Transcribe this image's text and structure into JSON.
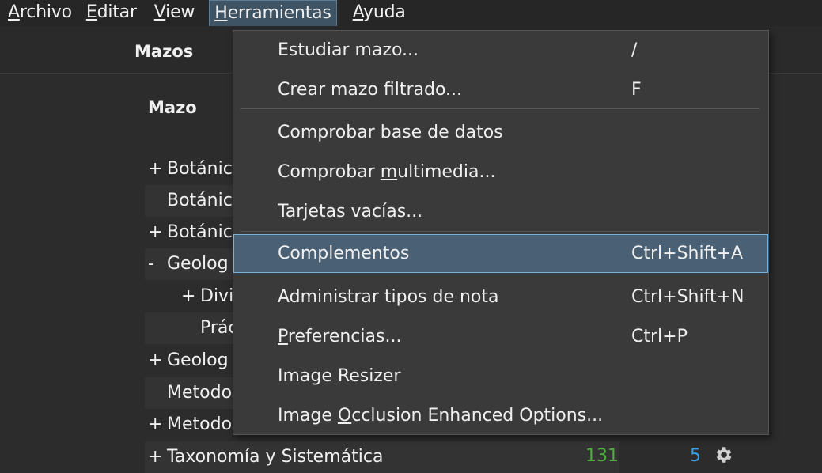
{
  "menubar": {
    "items": [
      {
        "pre": "",
        "ul": "A",
        "post": "rchivo"
      },
      {
        "pre": "",
        "ul": "E",
        "post": "ditar"
      },
      {
        "pre": "",
        "ul": "V",
        "post": "iew"
      },
      {
        "pre": "",
        "ul": "H",
        "post": "erramientas"
      },
      {
        "pre": "",
        "ul": "A",
        "post": "yuda"
      }
    ]
  },
  "toolbar": {
    "title": "Mazos"
  },
  "deck_list": {
    "header": "Mazo",
    "rows": [
      {
        "expander": "+",
        "name": "Botánic"
      },
      {
        "expander": "",
        "name": "Botánic"
      },
      {
        "expander": "+",
        "name": "Botánic"
      },
      {
        "expander": "-",
        "name": "Geolog"
      },
      {
        "expander": "+",
        "name": "Divi"
      },
      {
        "expander": "",
        "name": "Prác"
      },
      {
        "expander": "+",
        "name": "Geolog"
      },
      {
        "expander": "",
        "name": "Metodo"
      },
      {
        "expander": "+",
        "name": "Metodo"
      },
      {
        "expander": "+",
        "name": "Taxonomía y Sistemática",
        "new": "131",
        "learn": "5"
      }
    ]
  },
  "dropdown": {
    "items": [
      {
        "pre": "Estudiar mazo...",
        "ul": "",
        "post": "",
        "shortcut": "/"
      },
      {
        "pre": "Crear mazo filtrado...",
        "ul": "",
        "post": "",
        "shortcut": "F"
      },
      {
        "pre": "Comprobar base de datos",
        "ul": "",
        "post": "",
        "shortcut": ""
      },
      {
        "pre": "Comprobar ",
        "ul": "m",
        "post": "ultimedia...",
        "shortcut": ""
      },
      {
        "pre": "Tarjetas vacías...",
        "ul": "",
        "post": "",
        "shortcut": ""
      },
      {
        "pre": "Complementos",
        "ul": "",
        "post": "",
        "shortcut": "Ctrl+Shift+A"
      },
      {
        "pre": "Administrar tipos de nota",
        "ul": "",
        "post": "",
        "shortcut": "Ctrl+Shift+N"
      },
      {
        "pre": "",
        "ul": "P",
        "post": "referencias...",
        "shortcut": "Ctrl+P"
      },
      {
        "pre": "Image Resizer",
        "ul": "",
        "post": "",
        "shortcut": ""
      },
      {
        "pre": "Image ",
        "ul": "O",
        "post": "cclusion Enhanced Options...",
        "shortcut": ""
      }
    ]
  },
  "icons": {
    "gear": "gear-icon"
  }
}
